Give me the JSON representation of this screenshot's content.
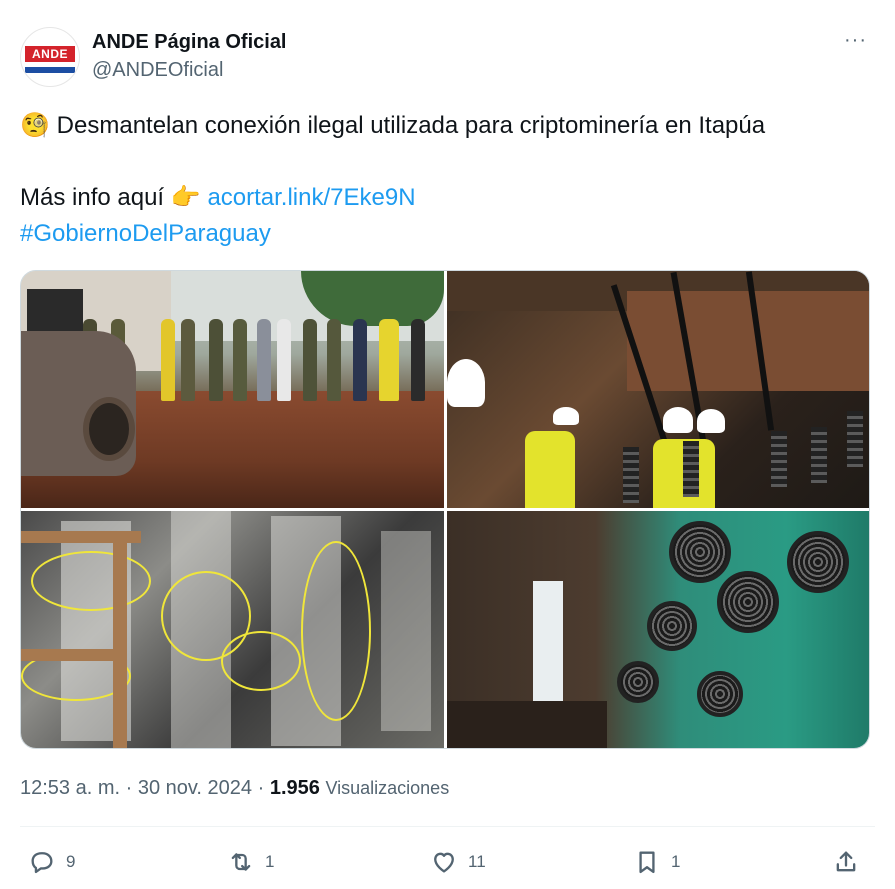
{
  "author": {
    "display_name": "ANDE Página Oficial",
    "handle": "@ANDEOficial",
    "avatar_text": "ANDE",
    "brand_colors": {
      "red": "#d4232b",
      "blue": "#1c4ea3",
      "white": "#ffffff"
    }
  },
  "more_menu": {
    "icon": "more-horizontal-icon",
    "label": "···"
  },
  "tweet": {
    "line1_emoji": "🧐",
    "line1_text": "Desmantelan conexión ilegal utilizada para criptominería en Itapúa",
    "line2_text": "Más info aquí",
    "line2_emoji": "👉",
    "link_text": "acortar.link/7Eke9N",
    "hashtag": "#GobiernoDelParaguay",
    "link_color": "#1d9bf0"
  },
  "media": {
    "count": 4,
    "photos": [
      {
        "subject": "group-at-muddy-site"
      },
      {
        "subject": "workers-with-power-lines"
      },
      {
        "subject": "mining-racks-with-yellow-cables"
      },
      {
        "subject": "wall-of-mining-fans"
      }
    ]
  },
  "meta": {
    "time": "12:53 a. m.",
    "separator": "·",
    "date": "30 nov. 2024",
    "views_count": "1.956",
    "views_label": "Visualizaciones"
  },
  "actions": {
    "reply": {
      "icon": "reply-icon",
      "count": "9"
    },
    "retweet": {
      "icon": "retweet-icon",
      "count": "1"
    },
    "like": {
      "icon": "heart-icon",
      "count": "11"
    },
    "bookmark": {
      "icon": "bookmark-icon",
      "count": "1"
    },
    "share": {
      "icon": "share-icon"
    }
  },
  "colors": {
    "text_primary": "#0f1419",
    "text_secondary": "#536471",
    "divider": "#eff3f4"
  }
}
